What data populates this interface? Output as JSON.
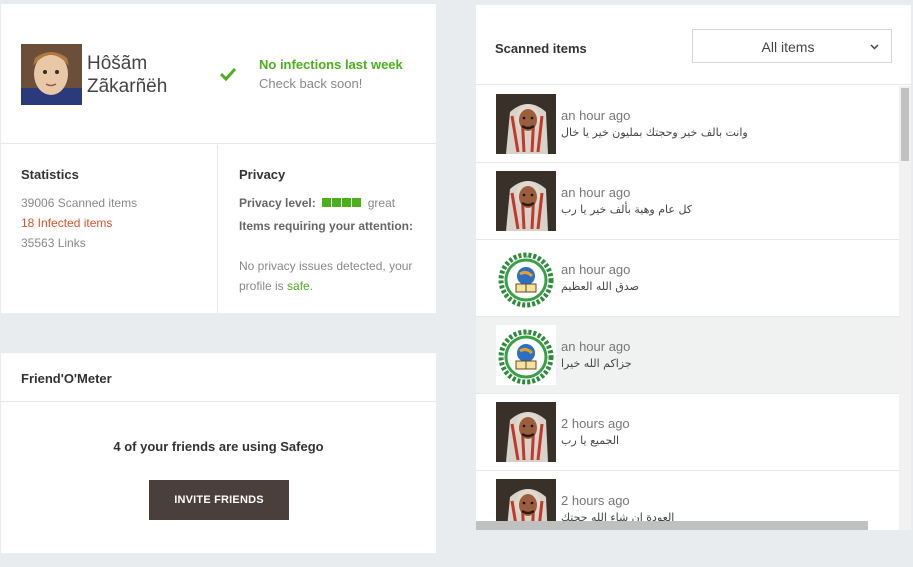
{
  "profile": {
    "user_name": "Hôšãm Zãkarñëh",
    "status_title": "No infections last week",
    "status_subtitle": "Check back soon!",
    "check_color": "#4caf1c"
  },
  "statistics": {
    "title": "Statistics",
    "scanned": "39006 Scanned items",
    "infected": "18 Infected items",
    "links": "35563 Links"
  },
  "privacy": {
    "title": "Privacy",
    "level_label": "Privacy level:",
    "level_bars_filled": 4,
    "level_bars_total": 4,
    "level_value": "great",
    "attention_label": "Items requiring your attention:",
    "message_pre": "No privacy issues detected, your profile is",
    "message_safe": "safe",
    "message_post": "."
  },
  "friendometer": {
    "title": "Friend'O'Meter",
    "count_text": "4 of your friends are using Safego",
    "invite_label": "INVITE FRIENDS"
  },
  "scanned": {
    "title": "Scanned items",
    "filter_value": "All items",
    "items": [
      {
        "time": "an hour ago",
        "text": "وانت بالف خير وحجتك بمليون خير يا خال",
        "thumb": "person-photo"
      },
      {
        "time": "an hour ago",
        "text": "كل عام وهية بألف خير يا رب",
        "thumb": "person-photo"
      },
      {
        "time": "an hour ago",
        "text": "صدق الله العظيم",
        "thumb": "emblem-logo"
      },
      {
        "time": "an hour ago",
        "text": "جزاكم الله خيرا",
        "thumb": "emblem-logo",
        "highlighted": true
      },
      {
        "time": "2 hours ago",
        "text": "الجميع يا رب",
        "thumb": "person-photo"
      },
      {
        "time": "2 hours ago",
        "text": "العودة إن شاء الله حجتك",
        "thumb": "person-photo"
      }
    ]
  },
  "colors": {
    "accent_green": "#4caf1c",
    "infected_red": "#d6542b",
    "button_dark": "#4a3f3b",
    "background": "#e8ecee"
  }
}
